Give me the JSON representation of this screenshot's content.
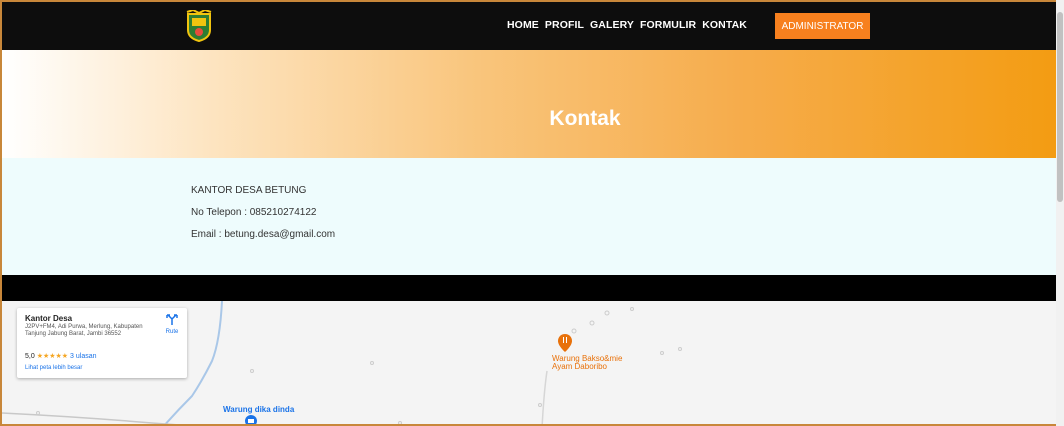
{
  "nav": {
    "items": [
      "HOME",
      "PROFIL",
      "GALERY",
      "FORMULIR",
      "KONTAK"
    ],
    "admin_label": "ADMINISTRATOR"
  },
  "hero": {
    "title": "Kontak"
  },
  "contact": {
    "name": "KANTOR DESA BETUNG",
    "phone": "No Telepon : 085210274122",
    "email": "Email : betung.desa@gmail.com"
  },
  "map": {
    "place_title": "Kantor Desa",
    "address": "J2PV+FM4, Adi Purwa, Merlung, Kabupaten Tanjung Jabung Barat, Jambi 36552",
    "rating": "5,0",
    "stars": "★★★★★",
    "reviews": "3 ulasan",
    "larger_map_link": "Lihat peta lebih besar",
    "route_label": "Rute",
    "poi_1": "Warung Bakso&mie",
    "poi_1b": "Ayam Daboribo",
    "poi_2": "Warung dika dinda",
    "colors": {
      "poi_food": "#e8710a",
      "poi_shop": "#1a73e8"
    }
  },
  "colors": {
    "accent": "#f7801e",
    "navbar": "#0d0d0d",
    "hero_end": "#f39c12",
    "info_bg": "#eefcfd"
  }
}
